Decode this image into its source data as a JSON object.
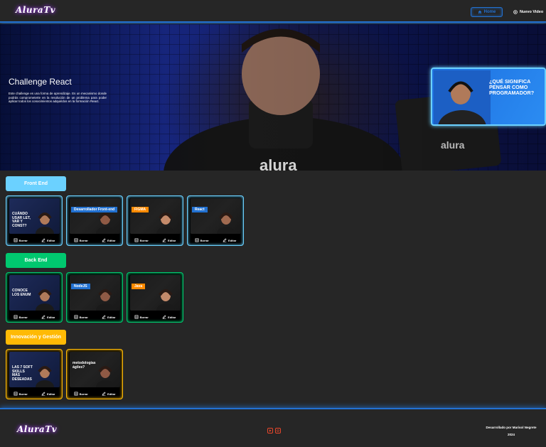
{
  "header": {
    "logo": "AluraTv",
    "home_label": "Home",
    "new_video_label": "Nuevo Video"
  },
  "banner": {
    "title": "Challenge React",
    "description": "Este challenge es una forma de aprendizaje. Es un mecanismo donde podrás comprometerte en la resolución de un problema para poder aplicar todos los conocimientos adquiridos en la formación React.",
    "thumb_text": "¿QUÉ SIGNIFICA PENSAR COMO PROGRAMADOR?"
  },
  "categories": [
    {
      "name": "Front End",
      "color": "#6bd1ff",
      "cards": [
        {
          "caption": "CUÁNDO USAR LET, VAR Y CONST?",
          "tag": ""
        },
        {
          "caption": "",
          "tag": "Desarrollador Front-end"
        },
        {
          "caption": "",
          "tag": "FIGMA"
        },
        {
          "caption": "",
          "tag": "React"
        }
      ]
    },
    {
      "name": "Back End",
      "color": "#00c86f",
      "cards": [
        {
          "caption": "CONOCE LOS ENUM",
          "tag": ""
        },
        {
          "caption": "",
          "tag": "NodeJS"
        },
        {
          "caption": "",
          "tag": "Java"
        }
      ]
    },
    {
      "name": "Innovación y Gestión",
      "color": "#ffba05",
      "cards": [
        {
          "caption": "LAS 7 SOFT SKILLS MÁS DESEADAS",
          "tag": ""
        },
        {
          "caption": "metodologías ágiles?",
          "tag": ""
        }
      ]
    }
  ],
  "card_actions": {
    "delete_label": "Borrar",
    "edit_label": "Editar"
  },
  "footer": {
    "logo": "AluraTv",
    "credit": "Desarrollado por Marisol Negrete",
    "year": "2024"
  },
  "colors": {
    "accent": "#2271d1",
    "frontend": "#6bd1ff",
    "backend": "#00c86f",
    "innovacion": "#ffba05",
    "social": "#e8472b"
  },
  "icons": [
    "home-icon",
    "plus-circle-icon",
    "trash-icon",
    "edit-icon",
    "youtube-icon",
    "instagram-icon"
  ]
}
